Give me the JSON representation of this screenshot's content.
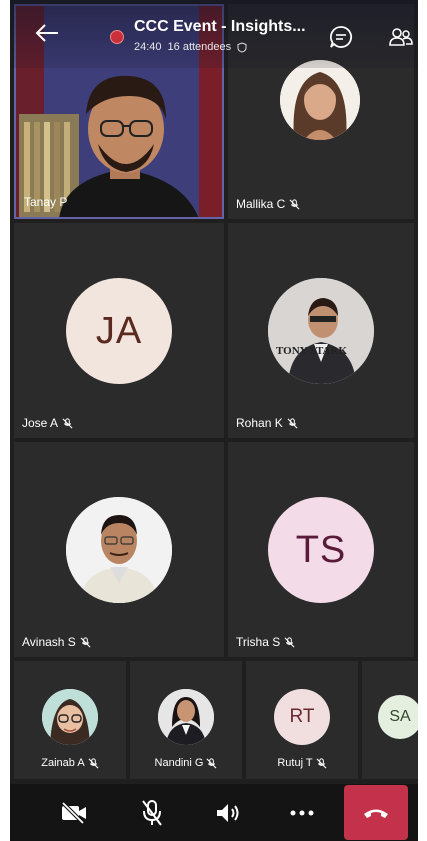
{
  "header": {
    "title": "CCC Event - Insights...",
    "duration": "24:40",
    "attendees": "16 attendees"
  },
  "participants": [
    {
      "name": "Tanay P",
      "muted": false,
      "type": "video"
    },
    {
      "name": "Mallika C",
      "muted": true,
      "type": "photo"
    },
    {
      "name": "Jose A",
      "muted": true,
      "type": "initials",
      "initials": "JA",
      "avatar_bg": "#f1e5de",
      "avatar_fg": "#5a2a1e"
    },
    {
      "name": "Rohan K",
      "muted": true,
      "type": "photo",
      "photo_caption": "TONY STARK"
    },
    {
      "name": "Avinash S",
      "muted": true,
      "type": "photo"
    },
    {
      "name": "Trisha S",
      "muted": true,
      "type": "initials",
      "initials": "TS",
      "avatar_bg": "#f3dce8",
      "avatar_fg": "#5a1a3a"
    }
  ],
  "strip": [
    {
      "name": "Zainab A",
      "muted": true,
      "type": "photo"
    },
    {
      "name": "Nandini G",
      "muted": true,
      "type": "photo"
    },
    {
      "name": "Rutuj T",
      "muted": true,
      "type": "initials",
      "initials": "RT",
      "avatar_bg": "#f1dedf",
      "avatar_fg": "#6a2a2e"
    },
    {
      "name": "",
      "muted": false,
      "type": "initials",
      "initials": "SA",
      "avatar_bg": "#e4efe0",
      "avatar_fg": "#2f4a2a"
    }
  ],
  "colors": {
    "accent": "#6264a7",
    "hangup": "#c4314b",
    "recording": "#c9303a"
  }
}
